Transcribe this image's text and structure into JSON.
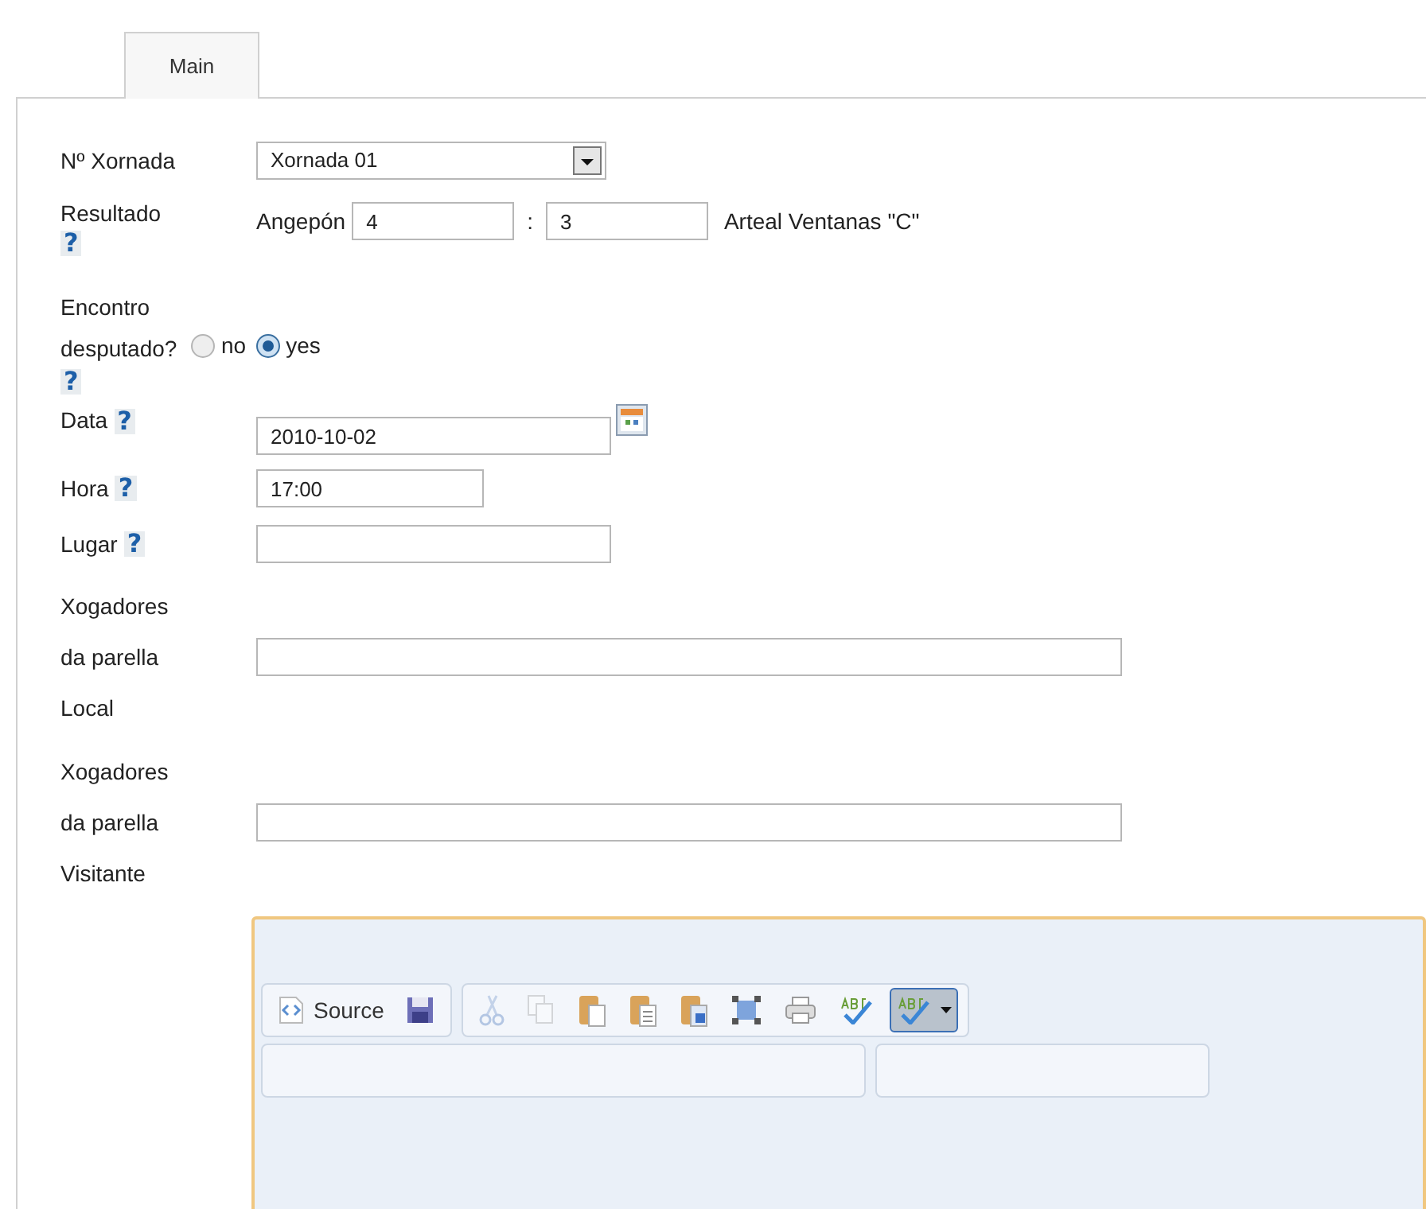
{
  "tabs": [
    {
      "label": "Main",
      "selected": true
    }
  ],
  "form": {
    "xornada": {
      "label": "Nº Xornada",
      "value": "Xornada 01"
    },
    "resultado": {
      "label": "Resultado",
      "help": "?",
      "home_team": "Angepón",
      "home_score": "4",
      "separator": ":",
      "away_score": "3",
      "away_team": "Arteal Ventanas \"C\""
    },
    "encontro": {
      "label": "Encontro desputado?",
      "help": "?",
      "options": [
        {
          "label": "no",
          "selected": false
        },
        {
          "label": "yes",
          "selected": true
        }
      ]
    },
    "data": {
      "label": "Data",
      "help": "?",
      "value": "2010-10-02"
    },
    "hora": {
      "label": "Hora",
      "help": "?",
      "value": "17:00"
    },
    "lugar": {
      "label": "Lugar",
      "help": "?"
    },
    "players": [
      {
        "label": "Xogadores da parella Local"
      },
      {
        "label": "Xogadores da parella Visitante"
      }
    ]
  },
  "editor": {
    "toolbar": [
      [
        {
          "kind": "source",
          "label": "Source",
          "disabled": false,
          "pressed": false
        },
        {
          "kind": "save",
          "disabled": false,
          "pressed": false
        }
      ],
      [
        {
          "kind": "cut",
          "disabled": true,
          "pressed": false
        },
        {
          "kind": "copy",
          "disabled": true,
          "pressed": false
        },
        {
          "kind": "paste",
          "disabled": false,
          "pressed": false
        },
        {
          "kind": "paste-text",
          "disabled": false,
          "pressed": false
        },
        {
          "kind": "paste-word",
          "disabled": false,
          "pressed": false
        },
        {
          "kind": "select-all",
          "disabled": false,
          "pressed": false
        },
        {
          "kind": "print",
          "disabled": false,
          "pressed": false
        },
        {
          "kind": "spellcheck",
          "disabled": false,
          "pressed": false
        },
        {
          "kind": "spellcheck-menu",
          "disabled": false,
          "pressed": true
        }
      ]
    ]
  }
}
